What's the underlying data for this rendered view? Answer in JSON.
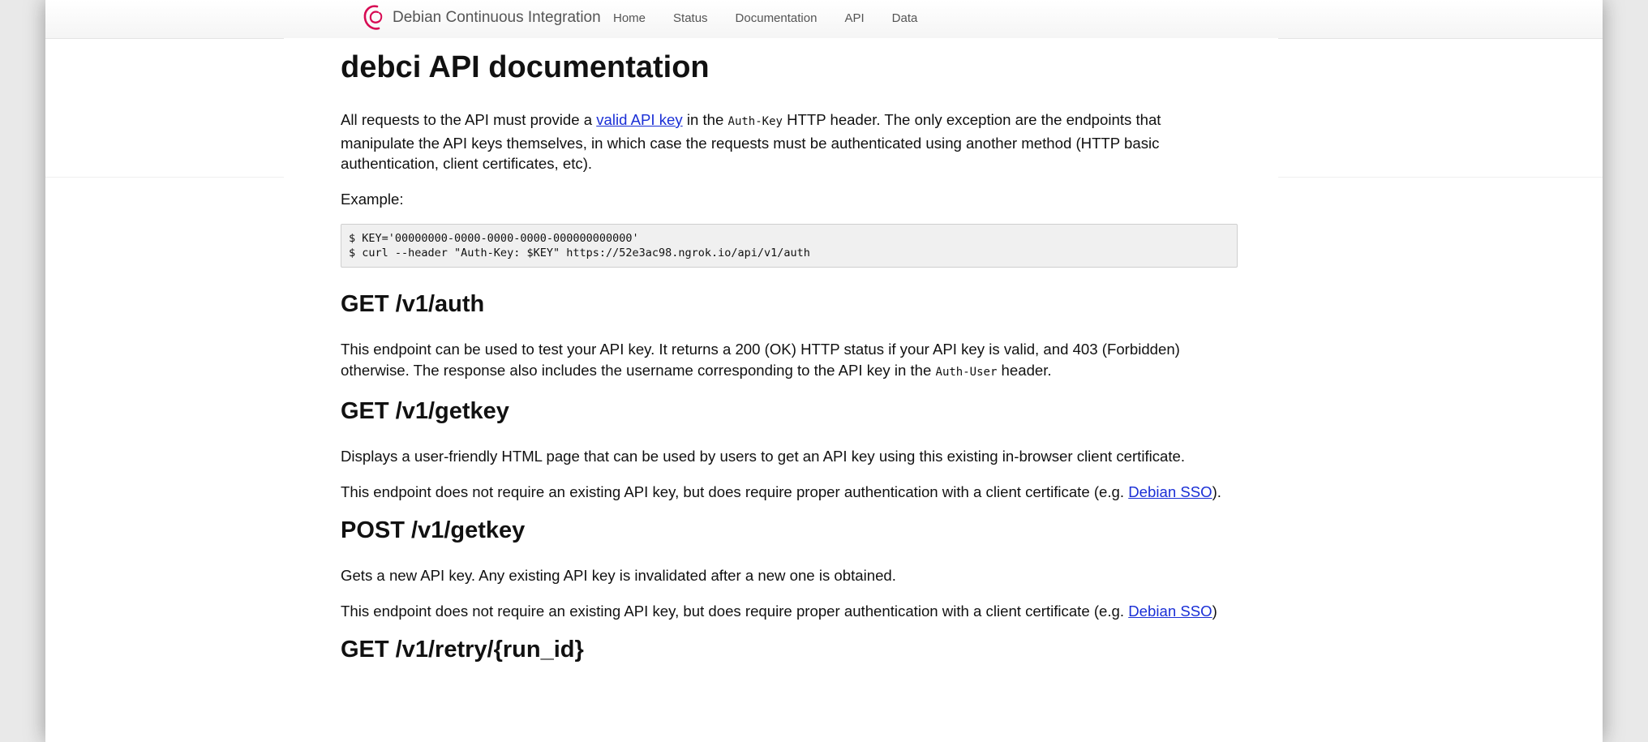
{
  "navbar": {
    "brand": "Debian Continuous Integration",
    "links": [
      "Home",
      "Status",
      "Documentation",
      "API",
      "Data"
    ]
  },
  "page": {
    "title": "debci API documentation",
    "intro": {
      "before_link": "All requests to the API must provide a ",
      "link": "valid API key",
      "between": " in the ",
      "code": "Auth-Key",
      "after_code": " HTTP header. The only exception are the endpoints that manipulate the API keys themselves, in which case the requests must be authenticated using another method (HTTP basic authentication, client certificates, etc)."
    },
    "example_label": "Example:",
    "code_lines": [
      "$ KEY='00000000-0000-0000-0000-000000000000'",
      "$ curl --header \"Auth-Key: $KEY\" https://52e3ac98.ngrok.io/api/v1/auth"
    ],
    "auth": {
      "heading": "GET /v1/auth",
      "text_before_code": "This endpoint can be used to test your API key. It returns a 200 (OK) HTTP status if your API key is valid, and 403 (Forbidden) otherwise. The response also includes the username corresponding to the API key in the ",
      "code": "Auth-User",
      "text_after_code": " header."
    },
    "get_getkey": {
      "heading": "GET /v1/getkey",
      "p1": "Displays a user-friendly HTML page that can be used by users to get an API key using this existing in-browser client certificate.",
      "p2_before_link": "This endpoint does not require an existing API key, but does require proper authentication with a client certificate (e.g. ",
      "p2_link": "Debian SSO",
      "p2_after_link": ")."
    },
    "post_getkey": {
      "heading": "POST /v1/getkey",
      "p1": "Gets a new API key. Any existing API key is invalidated after a new one is obtained.",
      "p2_before_link": "This endpoint does not require an existing API key, but does require proper authentication with a client certificate (e.g. ",
      "p2_link": "Debian SSO",
      "p2_after_link": ")"
    },
    "retry": {
      "heading": "GET /v1/retry/{run_id}"
    }
  },
  "colors": {
    "link": "#1a2fd6",
    "logo": "#d70a53",
    "code_bg": "#f0f0f0"
  }
}
